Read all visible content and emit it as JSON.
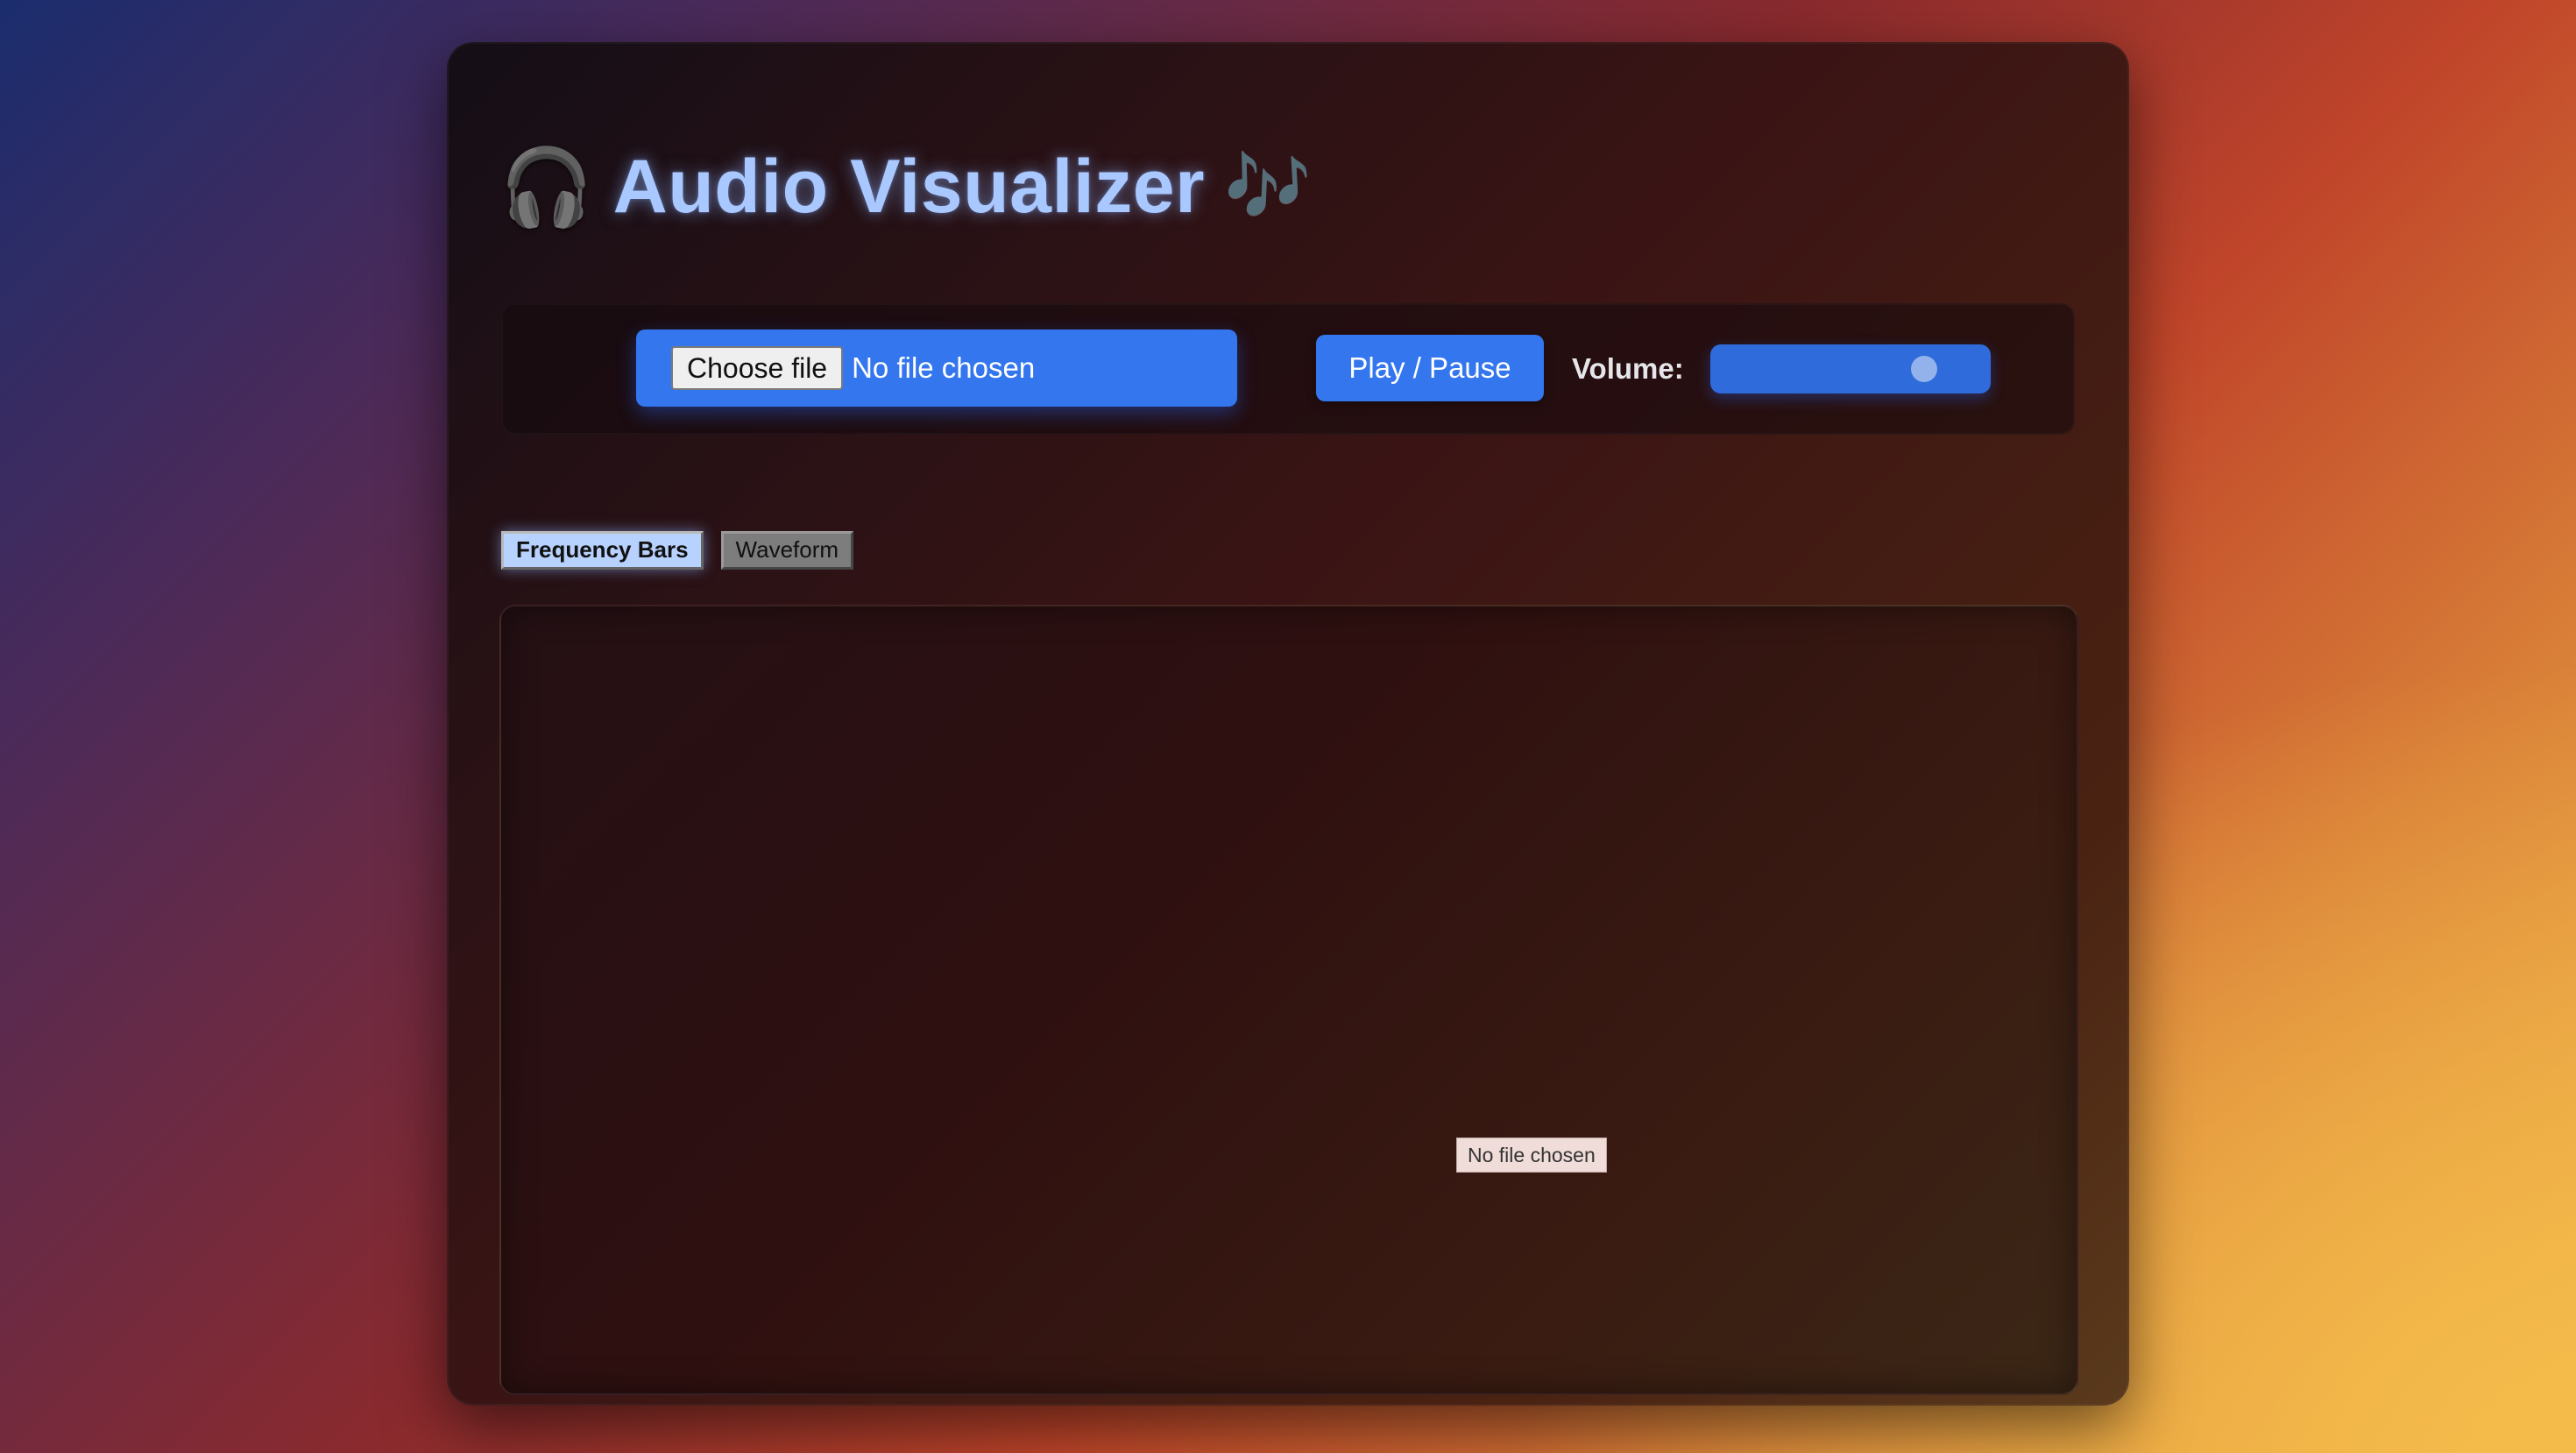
{
  "app": {
    "title": "Audio Visualizer",
    "title_icon_left": "headphones-icon",
    "title_icon_right": "music-notes-icon"
  },
  "controls": {
    "choose_file_label": "Choose file",
    "file_status": "No file chosen",
    "play_pause_label": "Play / Pause",
    "volume_label": "Volume:",
    "volume_value": 0.82
  },
  "tabs": [
    {
      "label": "Frequency Bars",
      "active": true
    },
    {
      "label": "Waveform",
      "active": false
    }
  ],
  "tooltip": {
    "text": "No file chosen"
  },
  "colors": {
    "accent": "#3376ee",
    "title": "#a9c8ff",
    "active_tab": "#b7d2ff"
  }
}
